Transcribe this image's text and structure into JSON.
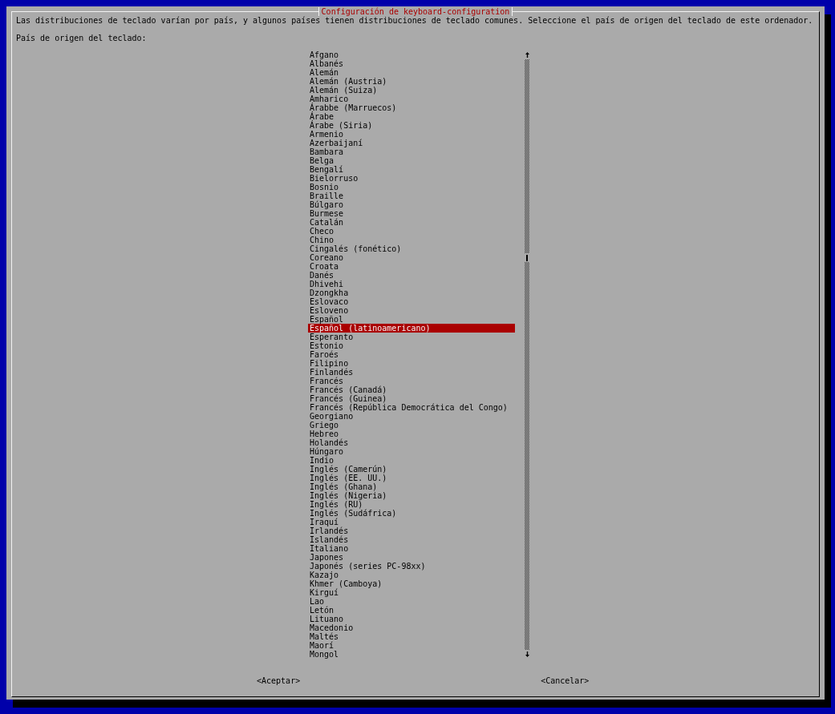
{
  "dialog": {
    "title": "Configuración de keyboard-configuration",
    "description": "Las distribuciones de teclado varían por país, y algunos países tienen distribuciones de teclado comunes. Seleccione el país de origen del teclado de este ordenador.",
    "prompt": "País de origen del teclado:"
  },
  "list": {
    "items": [
      {
        "label": "Afgano",
        "selected": false
      },
      {
        "label": "Albanés",
        "selected": false
      },
      {
        "label": "Alemán",
        "selected": false
      },
      {
        "label": "Alemán (Austria)",
        "selected": false
      },
      {
        "label": "Alemán (Suiza)",
        "selected": false
      },
      {
        "label": "Amharico",
        "selected": false
      },
      {
        "label": "Árabbe (Marruecos)",
        "selected": false
      },
      {
        "label": "Árabe",
        "selected": false
      },
      {
        "label": "Árabe (Siria)",
        "selected": false
      },
      {
        "label": "Armenio",
        "selected": false
      },
      {
        "label": "Azerbaijaní",
        "selected": false
      },
      {
        "label": "Bambara",
        "selected": false
      },
      {
        "label": "Belga",
        "selected": false
      },
      {
        "label": "Bengalí",
        "selected": false
      },
      {
        "label": "Bielorruso",
        "selected": false
      },
      {
        "label": "Bosnio",
        "selected": false
      },
      {
        "label": "Braille",
        "selected": false
      },
      {
        "label": "Búlgaro",
        "selected": false
      },
      {
        "label": "Burmese",
        "selected": false
      },
      {
        "label": "Catalán",
        "selected": false
      },
      {
        "label": "Checo",
        "selected": false
      },
      {
        "label": "Chino",
        "selected": false
      },
      {
        "label": "Cingalés (fonético)",
        "selected": false
      },
      {
        "label": "Coreano",
        "selected": false
      },
      {
        "label": "Croata",
        "selected": false
      },
      {
        "label": "Danés",
        "selected": false
      },
      {
        "label": "Dhivehi",
        "selected": false
      },
      {
        "label": "Dzongkha",
        "selected": false
      },
      {
        "label": "Eslovaco",
        "selected": false
      },
      {
        "label": "Esloveno",
        "selected": false
      },
      {
        "label": "Español",
        "selected": false
      },
      {
        "label": "Español (latinoamericano)",
        "selected": true
      },
      {
        "label": "Esperanto",
        "selected": false
      },
      {
        "label": "Estonio",
        "selected": false
      },
      {
        "label": "Faroés",
        "selected": false
      },
      {
        "label": "Filipino",
        "selected": false
      },
      {
        "label": "Finlandés",
        "selected": false
      },
      {
        "label": "Francés",
        "selected": false
      },
      {
        "label": "Francés (Canadá)",
        "selected": false
      },
      {
        "label": "Francés (Guinea)",
        "selected": false
      },
      {
        "label": "Francés (República Democrática del Congo)",
        "selected": false
      },
      {
        "label": "Georgiano",
        "selected": false
      },
      {
        "label": "Griego",
        "selected": false
      },
      {
        "label": "Hebreo",
        "selected": false
      },
      {
        "label": "Holandés",
        "selected": false
      },
      {
        "label": "Húngaro",
        "selected": false
      },
      {
        "label": "Indio",
        "selected": false
      },
      {
        "label": "Inglés (Camerún)",
        "selected": false
      },
      {
        "label": "Inglés (EE. UU.)",
        "selected": false
      },
      {
        "label": "Inglés (Ghana)",
        "selected": false
      },
      {
        "label": "Inglés (Nigeria)",
        "selected": false
      },
      {
        "label": "Inglés (RU)",
        "selected": false
      },
      {
        "label": "Inglés (Sudáfrica)",
        "selected": false
      },
      {
        "label": "Iraquí",
        "selected": false
      },
      {
        "label": "Irlandés",
        "selected": false
      },
      {
        "label": "Islandés",
        "selected": false
      },
      {
        "label": "Italiano",
        "selected": false
      },
      {
        "label": "Japones",
        "selected": false
      },
      {
        "label": "Japonés (series PC-98xx)",
        "selected": false
      },
      {
        "label": "Kazajo",
        "selected": false
      },
      {
        "label": "Khmer (Camboya)",
        "selected": false
      },
      {
        "label": "Kirguí",
        "selected": false
      },
      {
        "label": "Lao",
        "selected": false
      },
      {
        "label": "Letón",
        "selected": false
      },
      {
        "label": "Lituano",
        "selected": false
      },
      {
        "label": "Macedonio",
        "selected": false
      },
      {
        "label": "Maltés",
        "selected": false
      },
      {
        "label": "Maorí",
        "selected": false
      },
      {
        "label": "Mongol",
        "selected": false
      }
    ]
  },
  "buttons": [
    {
      "label": "<Aceptar>"
    },
    {
      "label": "<Cancelar>"
    }
  ]
}
